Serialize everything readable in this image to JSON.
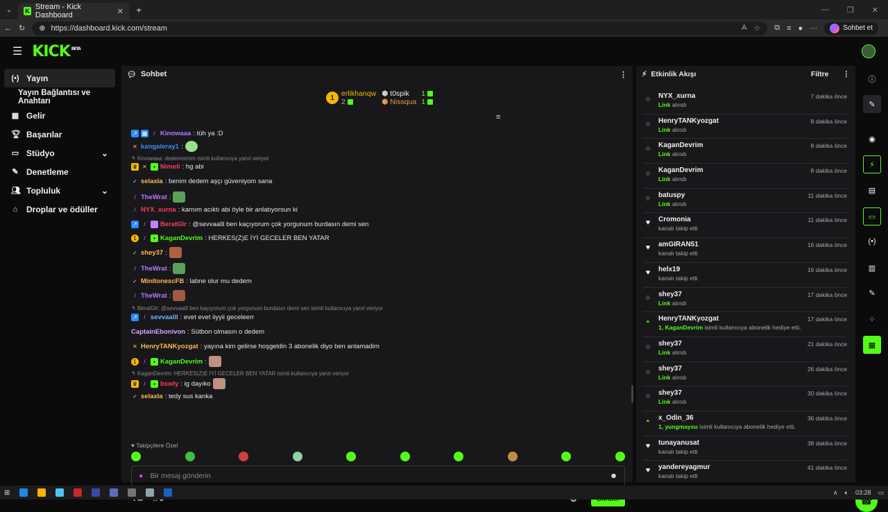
{
  "browser": {
    "tab_title": "Stream - Kick Dashboard",
    "url": "https://dashboard.kick.com/stream",
    "chat_button": "Sohbet et"
  },
  "brand": {
    "logo": "KICK",
    "beta": "BETA",
    "accent": "#53fc18"
  },
  "sidebar": {
    "items": [
      {
        "label": "Yayın",
        "icon": "broadcast-icon"
      },
      {
        "label": "Yayın Bağlantısı ve Anahtarı",
        "icon": ""
      },
      {
        "label": "Gelir",
        "icon": "revenue-icon"
      },
      {
        "label": "Başarılar",
        "icon": "trophy-icon"
      },
      {
        "label": "Stüdyo",
        "icon": "studio-icon"
      },
      {
        "label": "Denetleme",
        "icon": "wrench-icon"
      },
      {
        "label": "Topluluk",
        "icon": "community-icon"
      },
      {
        "label": "Droplar ve ödüller",
        "icon": "gift-icon"
      }
    ]
  },
  "chat": {
    "title": "Sohbet",
    "leaderboard": {
      "first": {
        "rank": "1",
        "name": "erlikhanqw",
        "count": "2"
      },
      "second": {
        "name": "t0spik",
        "count": "1"
      },
      "third": {
        "name": "Nissqua",
        "count": "1"
      }
    },
    "messages": [
      {
        "user": "Kinowaaa",
        "text": ": tüh ya :D",
        "color": "#b57bff"
      },
      {
        "user": "kangaleray1",
        "text": ":",
        "color": "#3a8cff"
      },
      {
        "reply": "Kinowaaa: dedemmmm isimli kullanıcıya yanıt veriyor"
      },
      {
        "user": "Nimeli",
        "text": ": hg abi",
        "color": "#ff3b5c"
      },
      {
        "user": "selaxla",
        "text": ": benim dedem aşçı güveniyom sana",
        "color": "#ffb84d"
      },
      {
        "user": "TheWrat",
        "text": ":",
        "color": "#b57bff"
      },
      {
        "user": "NYX_xurna",
        "text": ": karnım acıktı abi öyle bir anlatıyorsun ki",
        "color": "#ff3b5c"
      },
      {
        "user": "BeratGlr",
        "text": ": @sevvaalll ben kaçıyorum çok yorgunum burdasın demi sen",
        "color": "#ff3b5c"
      },
      {
        "user": "KaganDevrim",
        "text": ": HERKES(Z)E İYİ GECELER BEN YATAR",
        "color": "#53fc18"
      },
      {
        "user": "shey37",
        "text": ":",
        "color": "#ffb84d"
      },
      {
        "user": "TheWrat",
        "text": ":",
        "color": "#b57bff"
      },
      {
        "user": "MinitonescFB",
        "text": ": labne olur mu dedem",
        "color": "#ffb84d"
      },
      {
        "user": "TheWrat",
        "text": ":",
        "color": "#b57bff"
      },
      {
        "reply": "BeratGlr: @sevvaalll ben kaçıyorum çok yorgunum burdasın demi sen isimli kullanıcıya yanıt veriyor"
      },
      {
        "user": "sevvaalll",
        "text": ": evet evet iiyyii geceleerr",
        "color": "#6fb8ff"
      },
      {
        "user": "CaptainEbonivon",
        "text": ": Sütbon olmasın o dedem",
        "color": "#d9a8ff"
      },
      {
        "user": "HenryTANKyozgat",
        "text": ": yayına kim gelirse hoşgeldin 3 abonelik diyo ben anlamadim",
        "color": "#ffb84d"
      },
      {
        "user": "KaganDevrim",
        "text": ":",
        "color": "#53fc18"
      },
      {
        "reply": "KaganDevrim: HERKES(Z)E İYİ GECELER BEN YATAR isimli kullanıcıya yanıt veriyor"
      },
      {
        "user": "bswly",
        "text": ": ig dayıko",
        "color": "#ff3b5c"
      },
      {
        "user": "selaxla",
        "text": ": tedy sus kanka",
        "color": "#ffb84d"
      }
    ],
    "followers_only": "Takipçilere Özel",
    "input_placeholder": "Bir mesaj gönderin",
    "footer_count": "0",
    "send_label": "Gönder"
  },
  "activity": {
    "title": "Etkinlik Akışı",
    "filter_label": "Filtre",
    "events": [
      {
        "name": "NYX_xurna",
        "type": "link",
        "desc_hl": "Link",
        "desc": " alındı",
        "time": "7 dakika önce"
      },
      {
        "name": "HenryTANKyozgat",
        "type": "link",
        "desc_hl": "Link",
        "desc": " alındı",
        "time": "8 dakika önce"
      },
      {
        "name": "KaganDevrim",
        "type": "link",
        "desc_hl": "Link",
        "desc": " alındı",
        "time": "8 dakika önce"
      },
      {
        "name": "KaganDevrim",
        "type": "link",
        "desc_hl": "Link",
        "desc": " alındı",
        "time": "8 dakika önce"
      },
      {
        "name": "batuspy",
        "type": "link",
        "desc_hl": "Link",
        "desc": " alındı",
        "time": "11 dakika önce"
      },
      {
        "name": "Cromonia",
        "type": "follow",
        "desc_hl": "",
        "desc": "kanalı takip etti",
        "time": "11 dakika önce"
      },
      {
        "name": "amGIRAN51",
        "type": "follow",
        "desc_hl": "",
        "desc": "kanalı takip etti",
        "time": "16 dakika önce"
      },
      {
        "name": "helx19",
        "type": "follow",
        "desc_hl": "",
        "desc": "kanalı takip etti",
        "time": "16 dakika önce"
      },
      {
        "name": "shey37",
        "type": "link",
        "desc_hl": "Link",
        "desc": " alındı",
        "time": "17 dakika önce"
      },
      {
        "name": "HenryTANKyozgat",
        "type": "gift",
        "desc_hl": "1, KaganDevrim",
        "desc": " isimli kullanıcıya abonelik hediye etti.",
        "time": "17 dakika önce"
      },
      {
        "name": "shey37",
        "type": "link",
        "desc_hl": "Link",
        "desc": " alındı",
        "time": "21 dakika önce"
      },
      {
        "name": "shey37",
        "type": "link",
        "desc_hl": "Link",
        "desc": " alındı",
        "time": "26 dakika önce"
      },
      {
        "name": "shey37",
        "type": "link",
        "desc_hl": "Link",
        "desc": " alındı",
        "time": "30 dakika önce"
      },
      {
        "name": "x_Odin_36",
        "type": "gift",
        "desc_hl": "1, yungmaysu",
        "desc": " isimli kullanıcıya abonelik hediye etti.",
        "time": "36 dakika önce"
      },
      {
        "name": "tunayanusat",
        "type": "follow",
        "desc_hl": "",
        "desc": "kanalı takip etti",
        "time": "38 dakika önce"
      },
      {
        "name": "yandereyagmur",
        "type": "follow",
        "desc_hl": "",
        "desc": "kanalı takip etti",
        "time": "41 dakika önce"
      }
    ]
  },
  "taskbar": {
    "time": "03:28"
  }
}
